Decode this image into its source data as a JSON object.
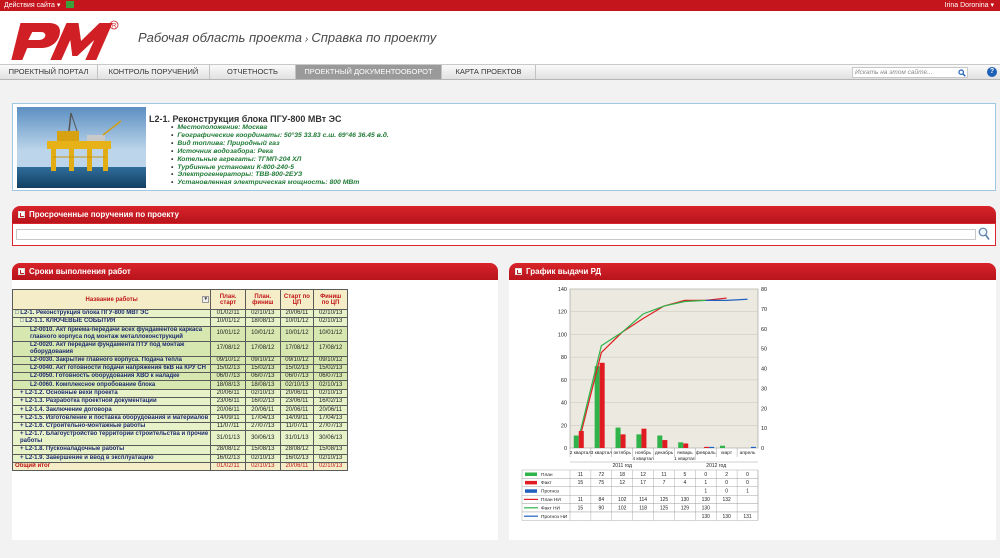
{
  "topbar": {
    "site_actions": "Действия сайта ▾",
    "user": "Irina Doronina ▾"
  },
  "header": {
    "logo_text": "PM",
    "workspace": "Рабочая область проекта",
    "separator": "›",
    "page": "Справка по проекту"
  },
  "nav": {
    "tabs": [
      "ПРОЕКТНЫЙ ПОРТАЛ",
      "КОНТРОЛЬ ПОРУЧЕНИЙ",
      "ОТЧЕТНОСТЬ",
      "ПРОЕКТНЫЙ ДОКУМЕНТООБОРОТ",
      "КАРТА ПРОЕКТОВ"
    ],
    "active": 3,
    "search_placeholder": "Искать на этом сайте...",
    "help": "?"
  },
  "project": {
    "title": "L2-1. Реконструкция блока ПГУ-800 МВт ЭС",
    "facts": [
      "Местоположение: Москва",
      "Географические координаты: 50°35 33.83 с.ш. 69°46 36.45 в.д.",
      "Вид топлива: Природный газ",
      "Источник водозабора: Река",
      "Котельные агрегаты: ТГМП-204 ХЛ",
      "Турбинные установки К-800-240-5",
      "Электрогенераторы: ТВВ-800-2ЕУЗ",
      "Установленная электрическая мощность: 800 МВт"
    ]
  },
  "overdue": {
    "title": "Просроченные поручения по проекту"
  },
  "schedule": {
    "title": "Сроки выполнения работ",
    "headers": [
      "Название работы",
      "План. старт",
      "План. финиш",
      "Старт по ЦП",
      "Финиш по ЦП"
    ],
    "rows": [
      {
        "name": "□ L2-1. Реконструкция блока ПГУ-800 МВт ЭС",
        "ps": "01/02/11",
        "pf": "02/10/13",
        "cs": "20/06/11",
        "cf": "02/10/13",
        "cls": "g",
        "indent": 0
      },
      {
        "name": "□ L2-1.1. КЛЮЧЕВЫЕ СОБЫТИЯ",
        "ps": "10/01/12",
        "pf": "18/08/13",
        "cs": "10/01/12",
        "cf": "02/10/13",
        "cls": "g",
        "indent": 1
      },
      {
        "name": "L2-0010. Акт приема-передачи всех фундаментов каркаса главного корпуса под монтаж металлоконструкций",
        "ps": "10/01/12",
        "pf": "10/01/12",
        "cs": "10/01/12",
        "cf": "10/01/12",
        "cls": "k",
        "indent": 3,
        "tall": true
      },
      {
        "name": "L2-0020. Акт передачи фундамента ПТУ под монтаж оборудования",
        "ps": "17/08/12",
        "pf": "17/08/12",
        "cs": "17/08/12",
        "cf": "17/08/12",
        "cls": "k",
        "indent": 3,
        "tall": true
      },
      {
        "name": "L2-0030. Закрытие главного корпуса. Подача тепла",
        "ps": "09/10/12",
        "pf": "09/10/12",
        "cs": "09/10/12",
        "cf": "09/10/12",
        "cls": "k",
        "indent": 3
      },
      {
        "name": "L2-0040. Акт готовности подачи напряжения 6кВ на КРУ СН",
        "ps": "15/02/13",
        "pf": "15/02/13",
        "cs": "15/02/13",
        "cf": "15/02/13",
        "cls": "k",
        "indent": 3
      },
      {
        "name": "L2-0050. Готовность оборудования ХВО к наладке",
        "ps": "06/07/13",
        "pf": "06/07/13",
        "cs": "06/07/13",
        "cf": "06/07/13",
        "cls": "k",
        "indent": 3
      },
      {
        "name": "L2-0060. Комплексное опробование блока",
        "ps": "18/08/13",
        "pf": "18/08/13",
        "cs": "02/10/13",
        "cf": "02/10/13",
        "cls": "k",
        "indent": 3
      },
      {
        "name": "+ L2-1.2. Основные вехи проекта",
        "ps": "20/06/11",
        "pf": "02/10/13",
        "cs": "20/06/11",
        "cf": "02/10/13",
        "cls": "g",
        "indent": 1
      },
      {
        "name": "+ L2-1.3. Разработка проектной документации",
        "ps": "23/06/11",
        "pf": "16/02/13",
        "cs": "23/06/11",
        "cf": "16/02/13",
        "cls": "g",
        "indent": 1
      },
      {
        "name": "+ L2-1.4. Заключение договора",
        "ps": "20/06/11",
        "pf": "20/06/11",
        "cs": "20/06/11",
        "cf": "20/06/11",
        "cls": "g",
        "indent": 1
      },
      {
        "name": "+ L2-1.5. Изготовление и поставка оборудования и материалов",
        "ps": "14/09/11",
        "pf": "17/04/13",
        "cs": "14/09/11",
        "cf": "17/04/13",
        "cls": "g",
        "indent": 1
      },
      {
        "name": "+ L2-1.6. Строительно-монтажные работы",
        "ps": "11/07/11",
        "pf": "27/07/13",
        "cs": "11/07/11",
        "cf": "27/07/13",
        "cls": "g",
        "indent": 1
      },
      {
        "name": "+ L2-1.7. Благоустройство территории строительства и прочие работы",
        "ps": "31/01/13",
        "pf": "30/06/13",
        "cs": "31/01/13",
        "cf": "30/06/13",
        "cls": "g",
        "indent": 1,
        "tall": true
      },
      {
        "name": "+ L2-1.8. Пусконаладочные работы",
        "ps": "28/08/12",
        "pf": "15/08/13",
        "cs": "28/08/12",
        "cf": "15/08/13",
        "cls": "g",
        "indent": 1
      },
      {
        "name": "+ L2-1.9. Завершение и ввод в эксплуатацию",
        "ps": "16/02/13",
        "pf": "02/10/13",
        "cs": "16/02/13",
        "cf": "02/10/13",
        "cls": "g",
        "indent": 1
      },
      {
        "name": "Общий итог",
        "ps": "01/02/11",
        "pf": "02/10/13",
        "cs": "20/06/11",
        "cf": "02/10/13",
        "cls": "t",
        "indent": 0
      }
    ]
  },
  "rd_chart": {
    "title": "График выдачи РД"
  },
  "chart_data": {
    "type": "bar",
    "categories": [
      "2 квартал",
      "3 квартал",
      "октябрь",
      "ноябрь",
      "декабрь",
      "январь",
      "февраль",
      "март",
      "апрель"
    ],
    "groups": [
      {
        "label": "2011 год",
        "from": 0,
        "to": 4
      },
      {
        "label": "2012 год",
        "from": 5,
        "to": 8
      }
    ],
    "sub_labels": {
      "5": "1 квартал",
      "3": "4 квартал"
    },
    "ylim": [
      0,
      140
    ],
    "y2lim": [
      0,
      80
    ],
    "yticks": [
      0,
      20,
      40,
      60,
      80,
      100,
      120,
      140
    ],
    "y2ticks": [
      0,
      10,
      20,
      30,
      40,
      50,
      60,
      70,
      80
    ],
    "series": [
      {
        "name": "План",
        "kind": "bar",
        "color": "#2fb34a",
        "values": [
          11,
          72,
          18,
          12,
          11,
          5,
          0,
          2,
          0
        ]
      },
      {
        "name": "Факт",
        "kind": "bar",
        "color": "#e01b22",
        "values": [
          15,
          75,
          12,
          17,
          7,
          4,
          1,
          0,
          0
        ]
      },
      {
        "name": "Прогноз",
        "kind": "bar",
        "color": "#2060c0",
        "values": [
          null,
          null,
          null,
          null,
          null,
          null,
          1,
          0,
          1
        ]
      },
      {
        "name": "План НИ",
        "kind": "line",
        "color": "#e01b22",
        "values": [
          11,
          84,
          102,
          114,
          125,
          130,
          130,
          132,
          null
        ]
      },
      {
        "name": "Факт НИ",
        "kind": "line",
        "color": "#2fb34a",
        "values": [
          15,
          90,
          102,
          118,
          125,
          129,
          130,
          null,
          null
        ]
      },
      {
        "name": "Прогноз НИ",
        "kind": "line",
        "color": "#2060c0",
        "values": [
          null,
          null,
          null,
          null,
          null,
          null,
          130,
          130,
          131
        ]
      }
    ],
    "table_display": [
      [
        "11",
        "72",
        "18",
        "12",
        "11",
        "5",
        "0",
        "2",
        "0"
      ],
      [
        "15",
        "75",
        "12",
        "17",
        "7",
        "4",
        "1",
        "0",
        "0"
      ],
      [
        "",
        "",
        "",
        "",
        "",
        "",
        "1",
        "0",
        "1"
      ],
      [
        "11",
        "84",
        "102",
        "114",
        "125",
        "130",
        "130",
        "132",
        ""
      ],
      [
        "15",
        "90",
        "102",
        "118",
        "125",
        "129",
        "130",
        "",
        ""
      ],
      [
        "",
        "",
        "",
        "",
        "",
        "",
        "130",
        "130",
        "131"
      ]
    ]
  }
}
